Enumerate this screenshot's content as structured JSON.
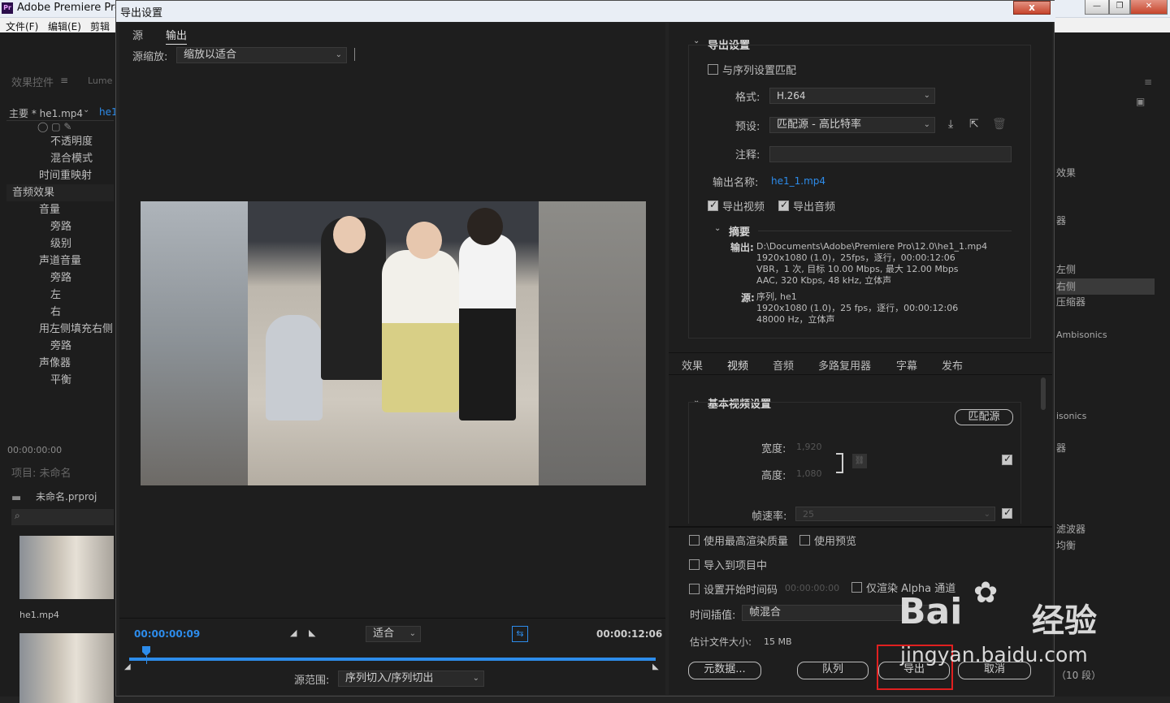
{
  "app": {
    "title": "Adobe Premiere Pro"
  },
  "menu": [
    "文件(F)",
    "编辑(E)",
    "剪辑"
  ],
  "left_panel": {
    "tab1": "效果控件",
    "tab2": "Lume",
    "clip_label": "主要 * he1.mp4",
    "clip_link": "he1",
    "rows": [
      "不透明度",
      "混合模式",
      "时间重映射",
      "音频效果",
      "音量",
      "旁路",
      "级别",
      "声道音量",
      "旁路",
      "左",
      "右",
      "用左侧填充右侧",
      "旁路",
      "声像器",
      "平衡"
    ],
    "timecode": "00:00:00:00",
    "project_title": "项目: 未命名",
    "project_file": "未命名.prproj",
    "media_name": "he1.mp4"
  },
  "right_panel": {
    "rows": [
      "效果",
      "器",
      "左侧",
      "右侧",
      "压缩器",
      "Ambisonics",
      "isonics",
      "器",
      "滤波器",
      "均衡",
      "（10 段）"
    ]
  },
  "dialog": {
    "title": "导出设置",
    "close": "x",
    "tabs": [
      "源",
      "输出"
    ],
    "source_scale_label": "源缩放:",
    "source_scale_value": "缩放以适合",
    "timecode_current": "00:00:00:09",
    "timecode_end": "00:00:12:06",
    "fit_value": "适合",
    "source_range_label": "源范围:",
    "source_range_value": "序列切入/序列切出",
    "export_settings_heading": "导出设置",
    "match_sequence": "与序列设置匹配",
    "format_label": "格式:",
    "format_value": "H.264",
    "preset_label": "预设:",
    "preset_value": "匹配源 - 高比特率",
    "comment_label": "注释:",
    "output_name_label": "输出名称:",
    "output_name_value": "he1_1.mp4",
    "export_video": "导出视频",
    "export_audio": "导出音频",
    "summary_heading": "摘要",
    "summary_output_label": "输出:",
    "summary_output_lines": [
      "D:\\Documents\\Adobe\\Premiere Pro\\12.0\\he1_1.mp4",
      "1920x1080 (1.0)，25fps，逐行，00:00:12:06",
      "VBR，1 次, 目标 10.00 Mbps, 最大 12.00 Mbps",
      "AAC, 320 Kbps, 48  kHz, 立体声"
    ],
    "summary_source_label": "源:",
    "summary_source_lines": [
      "序列, he1",
      "1920x1080 (1.0)，25 fps，逐行，00:00:12:06",
      "48000 Hz，立体声"
    ],
    "settings_tabs": [
      "效果",
      "视频",
      "音频",
      "多路复用器",
      "字幕",
      "发布"
    ],
    "basic_video_heading": "基本视频设置",
    "match_source_btn": "匹配源",
    "width_label": "宽度:",
    "width_value": "1,920",
    "height_label": "高度:",
    "height_value": "1,080",
    "frame_rate_label": "帧速率:",
    "frame_rate_value": "25",
    "max_render_quality": "使用最高渲染质量",
    "use_previews": "使用预览",
    "import_into_project": "导入到项目中",
    "set_start_timecode": "设置开始时间码",
    "start_timecode_value": "00:00:00:00",
    "render_alpha_only": "仅渲染 Alpha 通道",
    "time_interpolation_label": "时间插值:",
    "time_interpolation_value": "帧混合",
    "file_size_label": "估计文件大小:",
    "file_size_value": "15 MB",
    "btn_metadata": "元数据...",
    "btn_queue": "队列",
    "btn_export": "导出",
    "btn_cancel": "取消"
  },
  "watermark": {
    "logo": "Bai",
    "logo_cn": "经验",
    "url": "jingyan.baidu.com"
  }
}
